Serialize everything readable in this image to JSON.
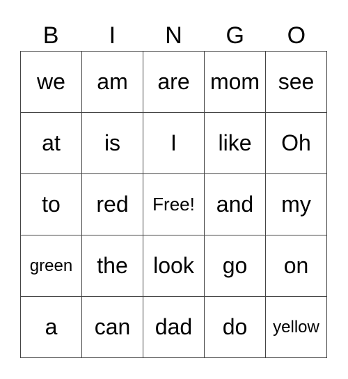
{
  "title_letters": [
    "B",
    "I",
    "N",
    "G",
    "O"
  ],
  "rows": [
    [
      "we",
      "am",
      "are",
      "mom",
      "see"
    ],
    [
      "at",
      "is",
      "I",
      "like",
      "Oh"
    ],
    [
      "to",
      "red",
      "Free!",
      "and",
      "my"
    ],
    [
      "green",
      "the",
      "look",
      "go",
      "on"
    ],
    [
      "a",
      "can",
      "dad",
      "do",
      "yellow"
    ]
  ]
}
